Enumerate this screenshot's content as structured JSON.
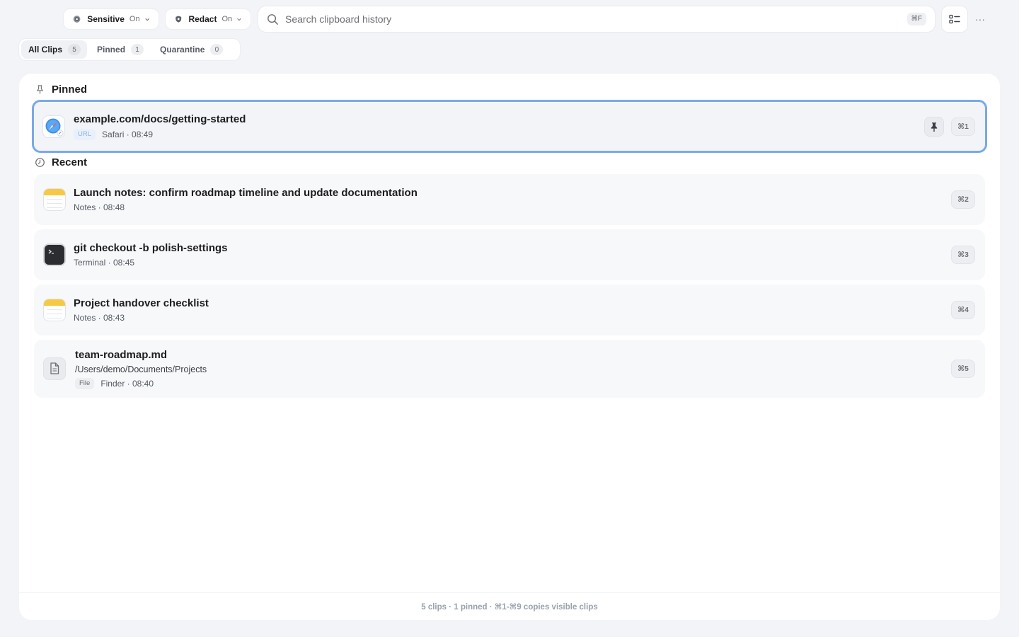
{
  "toolbar": {
    "sensitive": {
      "label": "Sensitive",
      "value": "On",
      "icon": "shield-dot-icon"
    },
    "redact": {
      "label": "Redact",
      "value": "On",
      "icon": "shield-icon"
    },
    "search": {
      "placeholder": "Search clipboard history",
      "shortcut": "⌘F"
    },
    "view_button_icon": "list-view-icon",
    "more_button": "···"
  },
  "tabs": [
    {
      "label": "All Clips",
      "count": "5",
      "active": true
    },
    {
      "label": "Pinned",
      "count": "1",
      "active": false
    },
    {
      "label": "Quarantine",
      "count": "0",
      "active": false
    }
  ],
  "sections": {
    "pinned": {
      "title": "Pinned",
      "icon": "pin-outline-icon"
    },
    "recent": {
      "title": "Recent",
      "icon": "clock-icon"
    }
  },
  "pinned_clips": [
    {
      "title": "example.com/docs/getting-started",
      "tag": "URL",
      "meta": "Safari · 08:49",
      "shortcut": "⌘1",
      "app": "safari-icon",
      "selected": true
    }
  ],
  "recent_clips": [
    {
      "title": "Launch notes: confirm roadmap timeline and update documentation",
      "meta": "Notes · 08:48",
      "shortcut": "⌘2",
      "app": "notes-icon"
    },
    {
      "title": "git checkout -b polish-settings",
      "meta": "Terminal · 08:45",
      "shortcut": "⌘3",
      "app": "terminal-icon"
    },
    {
      "title": "Project handover checklist",
      "meta": "Notes · 08:43",
      "shortcut": "⌘4",
      "app": "notes-icon"
    },
    {
      "title": "team-roadmap.md",
      "path": "/Users/demo/Documents/Projects",
      "tag": "File",
      "meta": "Finder · 08:40",
      "shortcut": "⌘5",
      "app": "file-icon"
    }
  ],
  "footer": {
    "text": "5 clips · 1 pinned · ⌘1-⌘9 copies visible clips"
  },
  "colors": {
    "accent": "#7aa9e6",
    "background": "#f3f4f7",
    "panel": "#ffffff"
  }
}
